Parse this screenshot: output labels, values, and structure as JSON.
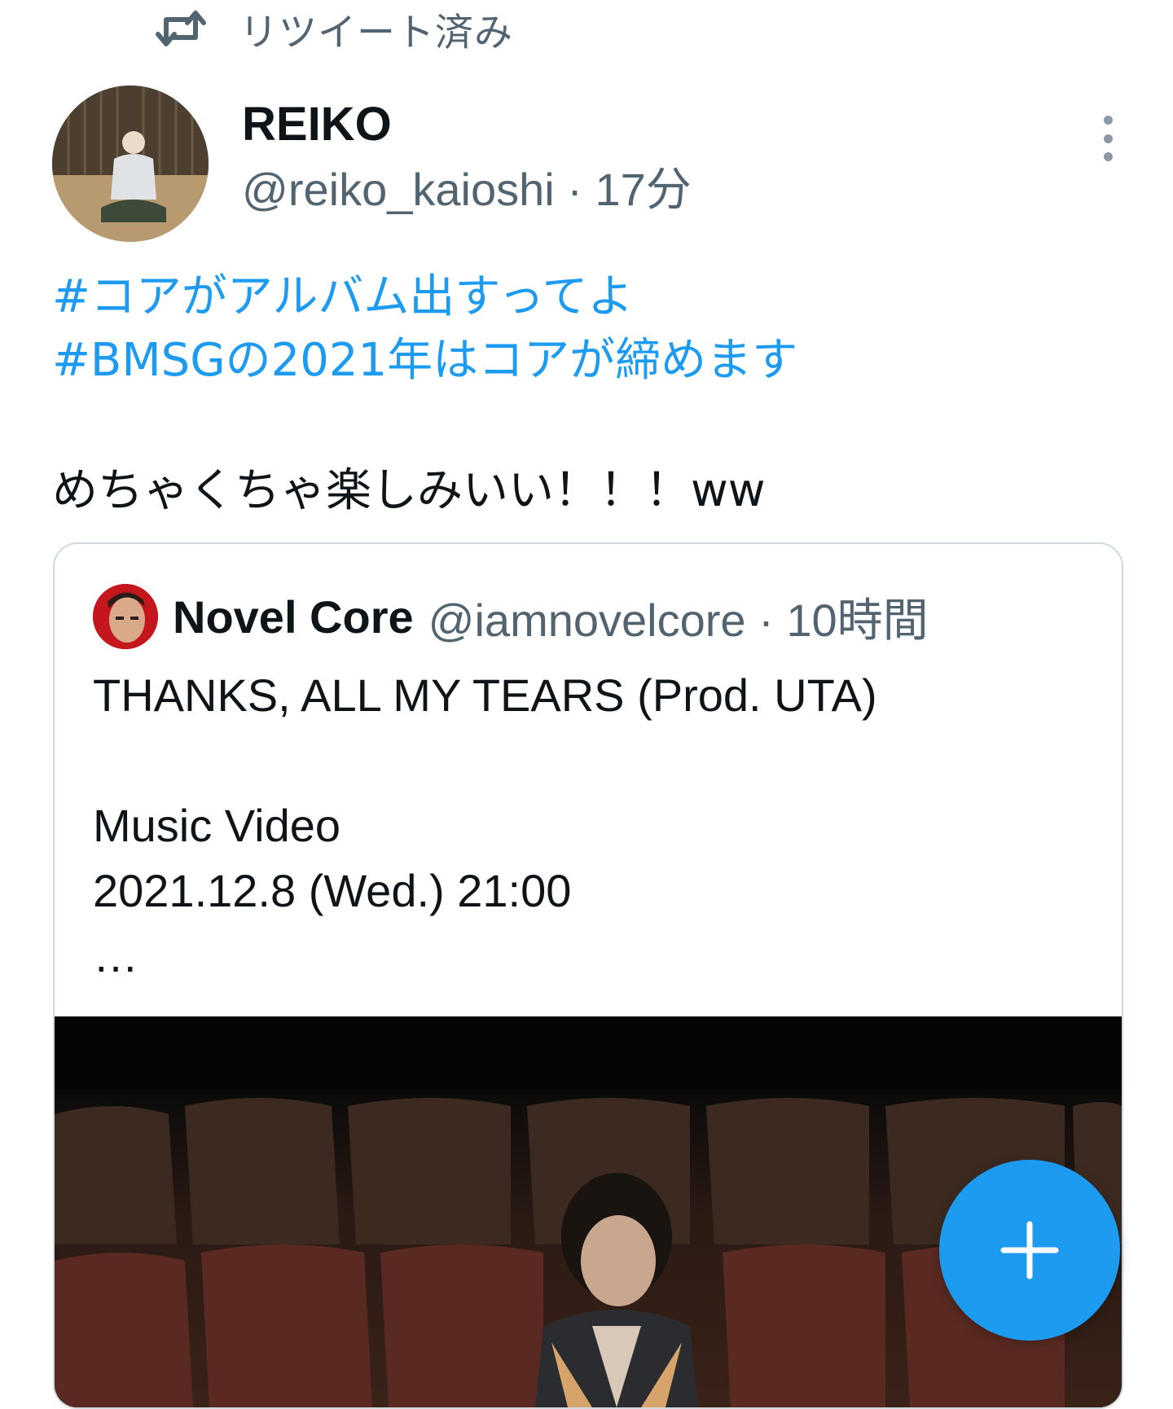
{
  "retweet": {
    "label": "リツイート済み",
    "icon": "retweet-icon"
  },
  "tweet": {
    "author_name": "REIKO",
    "author_handle": "@reiko_kaioshi",
    "separator": "·",
    "time": "17分",
    "more_icon": "more-vertical-icon",
    "hashtags": [
      "#コアがアルバム出すってよ",
      "#BMSGの2021年はコアが締めます"
    ],
    "text": "めちゃくちゃ楽しみいい！！！ww"
  },
  "quoted_tweet": {
    "author_name": "Novel Core",
    "author_handle": "@iamnovelcore",
    "separator": "·",
    "time": "10時間",
    "lines": [
      "THANKS, ALL MY TEARS (Prod. UTA)",
      "",
      "Music Video",
      "2021.12.8 (Wed.) 21:00",
      "…"
    ]
  },
  "fab": {
    "icon": "plus-icon"
  },
  "colors": {
    "accent": "#1d9bf0",
    "secondary_text": "#536471",
    "primary_text": "#0f1419",
    "border": "#cfd9de"
  }
}
